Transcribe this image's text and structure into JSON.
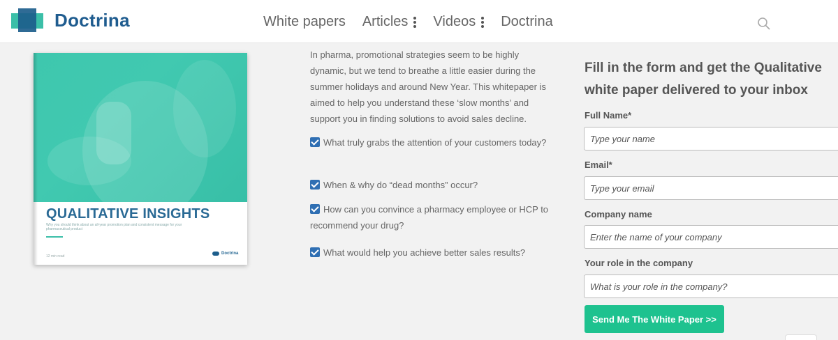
{
  "header": {
    "logo_text": "Doctrina",
    "nav": [
      {
        "label": "White papers",
        "has_menu": false
      },
      {
        "label": "Articles",
        "has_menu": true
      },
      {
        "label": "Videos",
        "has_menu": true
      },
      {
        "label": "Doctrina",
        "has_menu": false
      }
    ],
    "search_icon": "search-icon"
  },
  "book": {
    "title": "QUALITATIVE INSIGHTS",
    "subtitle": "Why you should think about an all-year promotion plan and consistent message for your pharmaceutical product",
    "footer": "12 min read",
    "logo_text": "Doctrina"
  },
  "description": "In pharma, promotional strategies seem to be highly dynamic, but we tend to breathe a little easier during the summer holidays and around New Year. This whitepaper is aimed to help you understand these ‘slow months’ and support you in finding solutions to avoid sales decline.",
  "checklist": [
    "What truly grabs the attention of your customers today?",
    "When & why do “dead months” occur?",
    "How can you convince a pharmacy employee or HCP to recommend your drug?",
    "What would help you achieve better sales results?"
  ],
  "form": {
    "title": "Fill in the form and get the Qualitative white paper delivered to your inbox",
    "fields": [
      {
        "label": "Full Name*",
        "placeholder": "Type your name"
      },
      {
        "label": "Email*",
        "placeholder": "Type your email"
      },
      {
        "label": "Company name",
        "placeholder": "Enter the name of your company"
      },
      {
        "label": "Your role in the company",
        "placeholder": "What is your role in the company?"
      }
    ],
    "submit_label": "Send Me The White Paper >>"
  },
  "colors": {
    "brand_blue": "#1f5c8f",
    "brand_teal": "#3bbfa8",
    "button_green": "#1ec28f",
    "checkbox_blue": "#2f6fb3"
  }
}
